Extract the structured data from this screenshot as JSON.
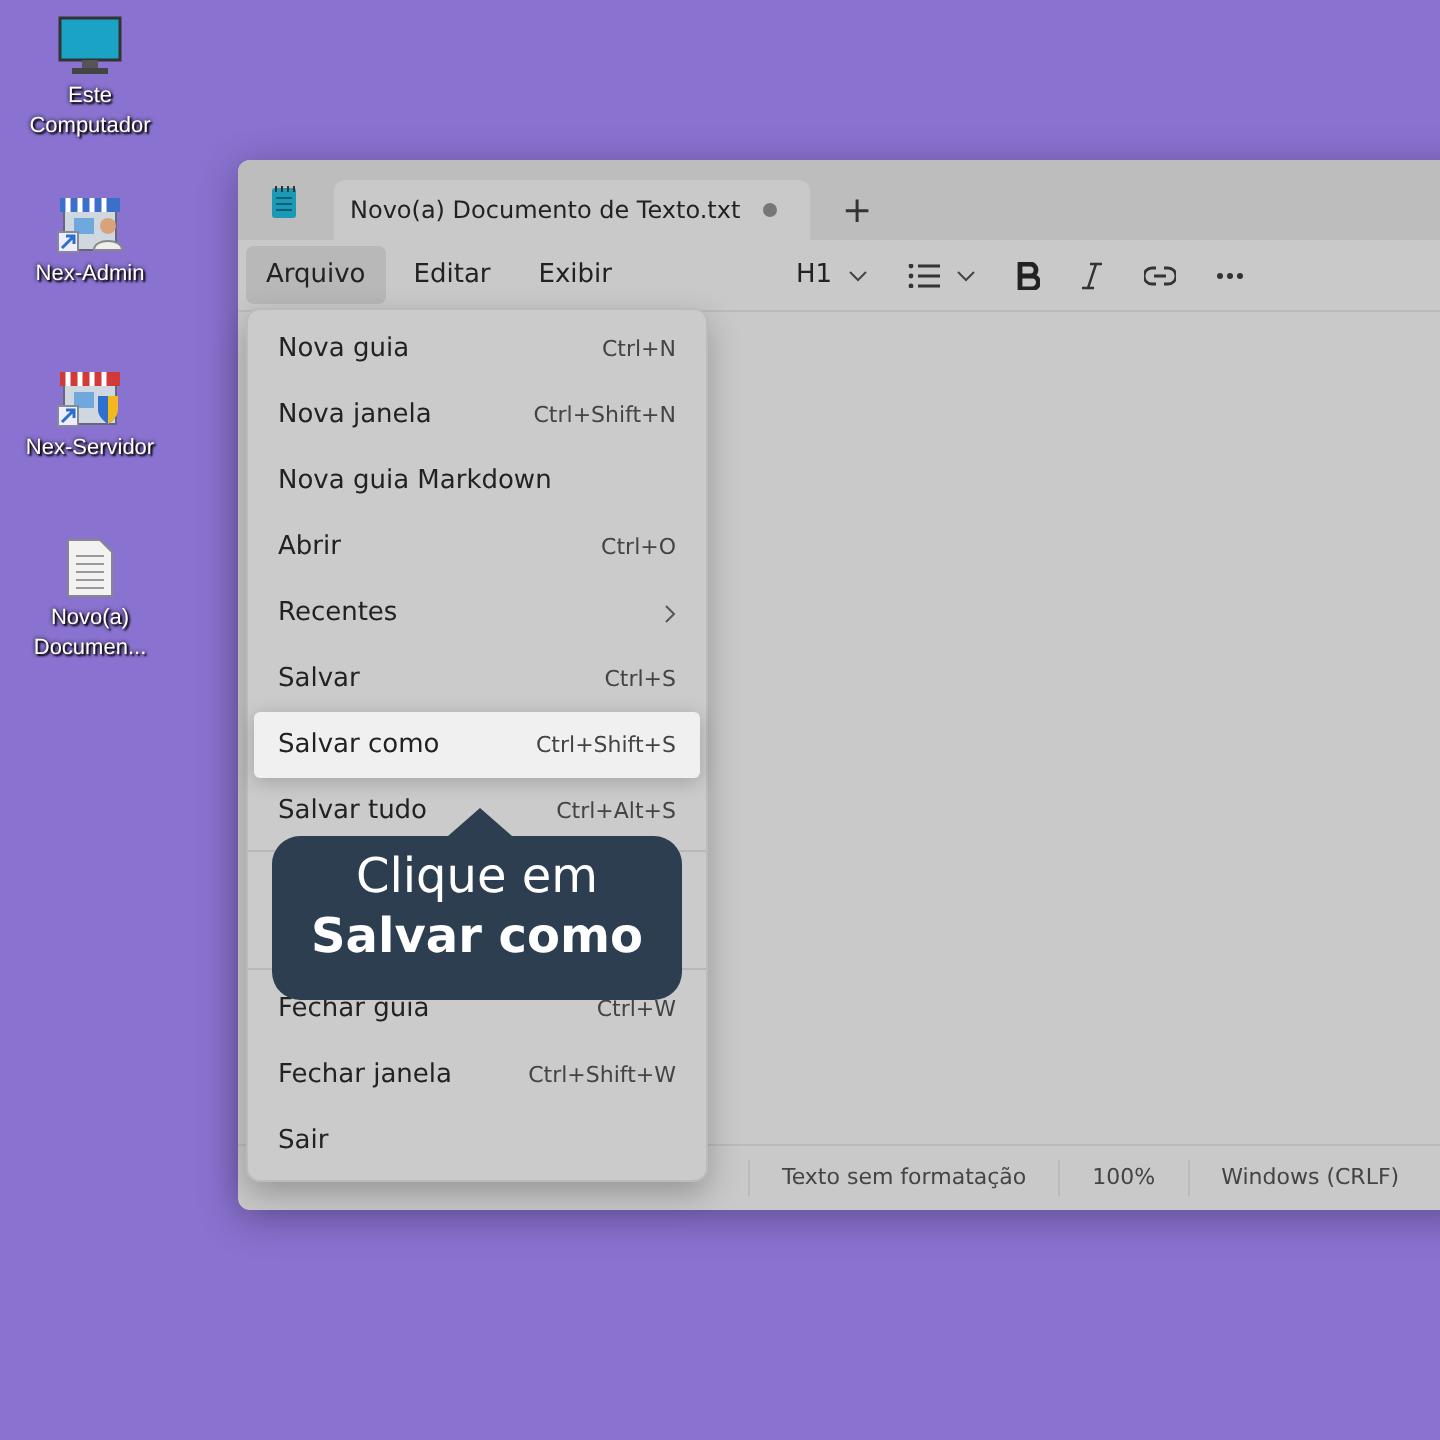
{
  "desktop_icons": [
    {
      "kind": "monitor",
      "label": "Este Computador"
    },
    {
      "kind": "store-admin",
      "label": "Nex-Admin"
    },
    {
      "kind": "store-server",
      "label": "Nex-Servidor"
    },
    {
      "kind": "document",
      "label": "Novo(a) Documen..."
    }
  ],
  "window": {
    "tab": {
      "title": "Novo(a) Documento de Texto.txt",
      "unsaved": true,
      "new_tab": "+"
    },
    "menubar": [
      {
        "label": "Arquivo",
        "selected": true
      },
      {
        "label": "Editar",
        "selected": false
      },
      {
        "label": "Exibir",
        "selected": false
      }
    ],
    "toolbar": {
      "heading": "H1"
    },
    "status_bar": [
      "Texto sem formatação",
      "100%",
      "Windows (CRLF)"
    ]
  },
  "menu": {
    "groups": [
      [
        {
          "kind": "item",
          "label": "Nova guia",
          "shortcut": "Ctrl+N",
          "selected": false
        },
        {
          "kind": "item",
          "label": "Nova janela",
          "shortcut": "Ctrl+Shift+N",
          "selected": false
        },
        {
          "kind": "item",
          "label": "Nova guia Markdown",
          "selected": false
        },
        {
          "kind": "item",
          "label": "Abrir",
          "shortcut": "Ctrl+O",
          "selected": false
        },
        {
          "kind": "submenu",
          "label": "Recentes",
          "selected": false
        },
        {
          "kind": "item",
          "label": "Salvar",
          "shortcut": "Ctrl+S",
          "selected": false
        },
        {
          "kind": "item",
          "label": "Salvar como",
          "shortcut": "Ctrl+Shift+S",
          "selected": true
        },
        {
          "kind": "item",
          "label": "Salvar tudo",
          "shortcut": "Ctrl+Alt+S",
          "selected": false
        }
      ],
      [
        {
          "kind": "item",
          "label": "Fechar guia",
          "shortcut": "Ctrl+W",
          "selected": false
        },
        {
          "kind": "item",
          "label": "Fechar janela",
          "shortcut": "Ctrl+Shift+W",
          "selected": false
        },
        {
          "kind": "item",
          "label": "Sair",
          "selected": false
        }
      ]
    ]
  },
  "callout": {
    "text": "Clique em\n**Salvar como**"
  }
}
